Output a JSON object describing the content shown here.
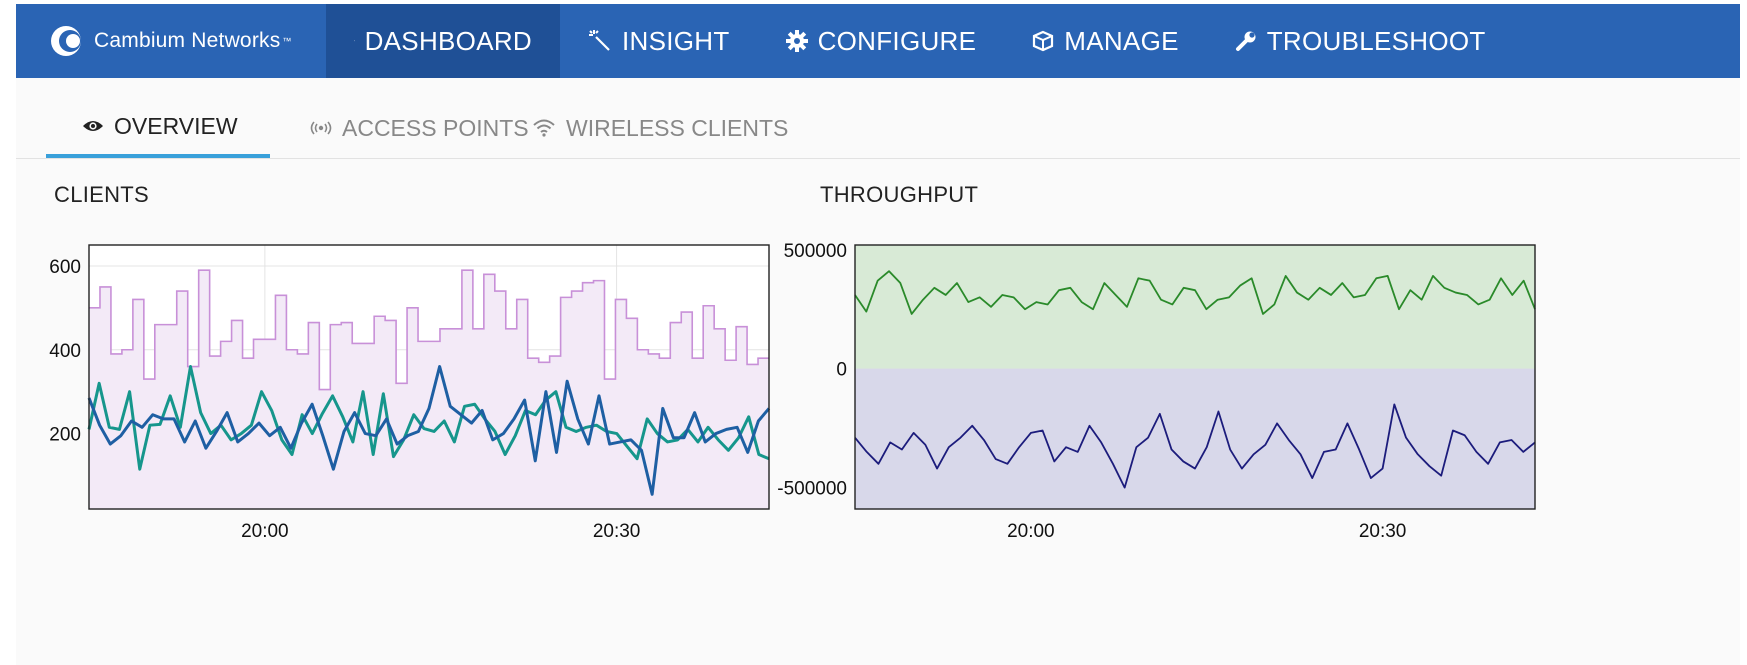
{
  "brand": {
    "name": "Cambium Networks",
    "tm": "™"
  },
  "nav": {
    "items": [
      {
        "label": "DASHBOARD",
        "icon": "monitor-icon",
        "active": true
      },
      {
        "label": "INSIGHT",
        "icon": "magic-wand-icon",
        "active": false
      },
      {
        "label": "CONFIGURE",
        "icon": "gear-icon",
        "active": false
      },
      {
        "label": "MANAGE",
        "icon": "cube-icon",
        "active": false
      },
      {
        "label": "TROUBLESHOOT",
        "icon": "wrench-icon",
        "active": false
      }
    ]
  },
  "tabs": [
    {
      "label": "OVERVIEW",
      "icon": "eye-icon",
      "active": true
    },
    {
      "label": "ACCESS POINTS",
      "icon": "broadcast-icon",
      "active": false
    },
    {
      "label": "WIRELESS CLIENTS",
      "icon": "wifi-icon",
      "active": false
    }
  ],
  "colors": {
    "nav_bg": "#2a64b4",
    "nav_active": "#1f5096",
    "tab_underline": "#39a0da",
    "clients_total": "#c890d8",
    "clients_fill": "#f3eaf7",
    "clients_series_teal": "#16968c",
    "clients_series_blue": "#1e5fa3",
    "tx_line": "#2a8a2a",
    "tx_fill": "#d8ead6",
    "rx_line": "#1c1c7c",
    "rx_fill": "#d8d8ea"
  },
  "chart_data": [
    {
      "title": "CLIENTS",
      "type": "line",
      "x_start_minutes": -15,
      "x_end_minutes": 43,
      "x_ticks": [
        "20:00",
        "20:30"
      ],
      "ylim": [
        20,
        650
      ],
      "y_ticks": [
        200,
        400,
        600
      ],
      "grid": true,
      "series": [
        {
          "style": "step-area",
          "values": [
            500,
            550,
            390,
            400,
            520,
            330,
            460,
            460,
            540,
            360,
            590,
            385,
            420,
            470,
            380,
            425,
            425,
            530,
            400,
            390,
            465,
            305,
            460,
            465,
            415,
            415,
            480,
            470,
            320,
            500,
            420,
            420,
            450,
            450,
            590,
            450,
            580,
            540,
            450,
            520,
            380,
            370,
            385,
            525,
            540,
            560,
            565,
            330,
            520,
            475,
            400,
            390,
            380,
            465,
            490,
            380,
            505,
            450,
            375,
            455,
            365,
            380
          ]
        },
        {
          "style": "line",
          "values": [
            210,
            320,
            215,
            210,
            300,
            115,
            220,
            222,
            290,
            215,
            360,
            250,
            200,
            220,
            185,
            200,
            220,
            300,
            255,
            185,
            150,
            245,
            200,
            248,
            290,
            240,
            180,
            300,
            150,
            295,
            145,
            185,
            245,
            212,
            205,
            230,
            180,
            265,
            270,
            235,
            205,
            150,
            195,
            255,
            245,
            280,
            300,
            215,
            205,
            215,
            220,
            205,
            200,
            170,
            140,
            235,
            200,
            180,
            185,
            210,
            180,
            215,
            185,
            160,
            190,
            240,
            150,
            140
          ]
        },
        {
          "style": "line",
          "values": [
            285,
            220,
            175,
            195,
            230,
            215,
            245,
            235,
            235,
            180,
            230,
            165,
            205,
            250,
            180,
            200,
            225,
            195,
            215,
            165,
            225,
            270,
            195,
            115,
            205,
            250,
            200,
            195,
            235,
            175,
            195,
            205,
            260,
            360,
            265,
            245,
            225,
            255,
            185,
            200,
            235,
            280,
            135,
            300,
            155,
            325,
            235,
            175,
            290,
            175,
            180,
            185,
            160,
            55,
            260,
            190,
            190,
            250,
            180,
            200,
            210,
            215,
            155,
            230,
            260
          ]
        }
      ]
    },
    {
      "title": "THROUGHPUT",
      "type": "area",
      "x_start_minutes": -15,
      "x_end_minutes": 43,
      "x_ticks": [
        "20:00",
        "20:30"
      ],
      "ylim": [
        -590000,
        520000
      ],
      "y_ticks": [
        -500000,
        0,
        500000
      ],
      "grid": true,
      "series": [
        {
          "style": "area-positive",
          "values": [
            310000,
            240000,
            370000,
            410000,
            360000,
            230000,
            290000,
            340000,
            310000,
            360000,
            280000,
            300000,
            260000,
            310000,
            300000,
            250000,
            280000,
            270000,
            330000,
            340000,
            280000,
            250000,
            360000,
            310000,
            260000,
            380000,
            370000,
            290000,
            270000,
            340000,
            330000,
            250000,
            290000,
            300000,
            350000,
            380000,
            230000,
            270000,
            390000,
            320000,
            290000,
            340000,
            310000,
            360000,
            300000,
            310000,
            380000,
            390000,
            250000,
            330000,
            290000,
            390000,
            340000,
            320000,
            310000,
            270000,
            290000,
            380000,
            310000,
            370000,
            250000
          ]
        },
        {
          "style": "area-negative",
          "values": [
            -290000,
            -350000,
            -400000,
            -310000,
            -340000,
            -270000,
            -320000,
            -420000,
            -330000,
            -290000,
            -240000,
            -300000,
            -380000,
            -400000,
            -330000,
            -270000,
            -260000,
            -390000,
            -330000,
            -350000,
            -240000,
            -310000,
            -400000,
            -500000,
            -330000,
            -290000,
            -190000,
            -340000,
            -390000,
            -420000,
            -330000,
            -180000,
            -340000,
            -420000,
            -360000,
            -320000,
            -230000,
            -300000,
            -360000,
            -460000,
            -350000,
            -340000,
            -230000,
            -340000,
            -460000,
            -420000,
            -150000,
            -290000,
            -360000,
            -410000,
            -450000,
            -260000,
            -280000,
            -350000,
            -400000,
            -310000,
            -300000,
            -350000,
            -310000
          ]
        }
      ]
    }
  ]
}
